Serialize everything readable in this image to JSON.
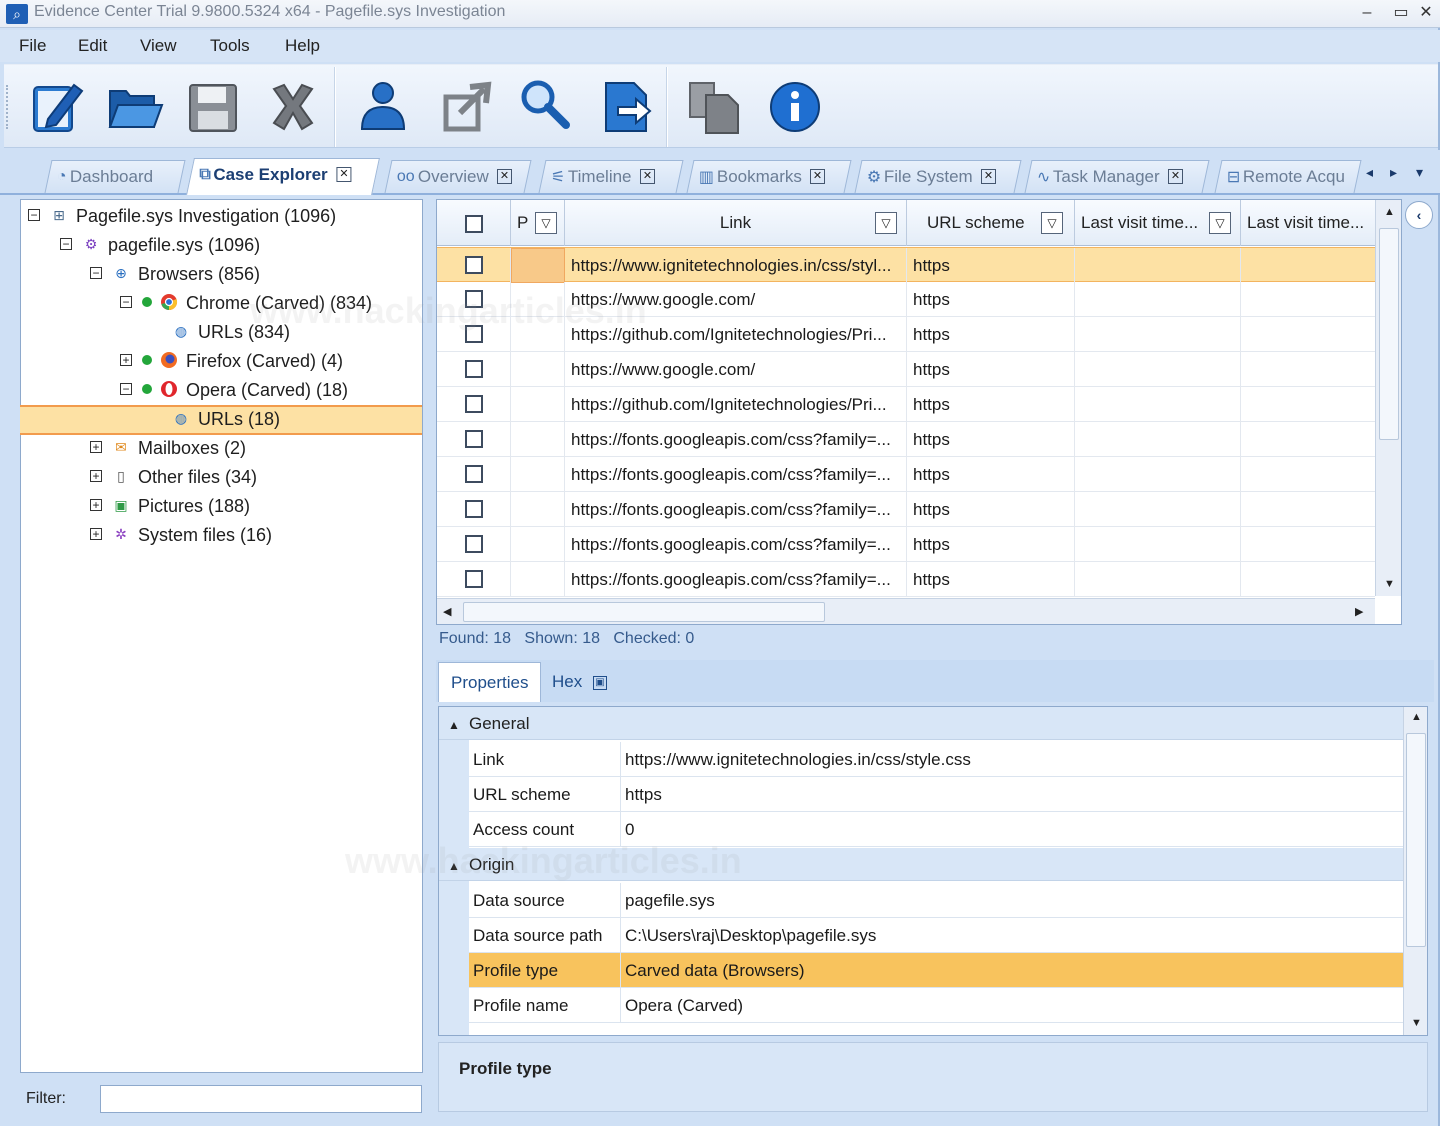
{
  "window": {
    "title": "Evidence Center Trial 9.9800.5324 x64 - Pagefile.sys Investigation"
  },
  "menu": [
    "File",
    "Edit",
    "View",
    "Tools",
    "Help"
  ],
  "toolbar": [
    "new-case",
    "open-case",
    "save-case",
    "close-case",
    "add-evidence",
    "export",
    "search",
    "report",
    "copy",
    "about"
  ],
  "tabs": [
    {
      "label": "Dashboard",
      "icon": "dashboard-icon",
      "closable": false,
      "active": false
    },
    {
      "label": "Case Explorer",
      "icon": "case-explorer-icon",
      "closable": true,
      "active": true
    },
    {
      "label": "Overview",
      "icon": "overview-icon",
      "closable": true,
      "active": false
    },
    {
      "label": "Timeline",
      "icon": "timeline-icon",
      "closable": true,
      "active": false
    },
    {
      "label": "Bookmarks",
      "icon": "bookmarks-icon",
      "closable": true,
      "active": false
    },
    {
      "label": "File System",
      "icon": "file-system-icon",
      "closable": true,
      "active": false
    },
    {
      "label": "Task Manager",
      "icon": "task-manager-icon",
      "closable": true,
      "active": false
    },
    {
      "label": "Remote Acqu",
      "icon": "remote-acquisition-icon",
      "closable": false,
      "active": false
    }
  ],
  "tree": [
    {
      "label": "Pagefile.sys Investigation (1096)",
      "level": 0,
      "expander": "⊟",
      "icon": "investigation-icon"
    },
    {
      "label": "pagefile.sys (1096)",
      "level": 1,
      "expander": "⊟",
      "icon": "gear-icon"
    },
    {
      "label": "Browsers (856)",
      "level": 2,
      "expander": "⊟",
      "icon": "globe-icon"
    },
    {
      "label": "Chrome (Carved) (834)",
      "level": 3,
      "expander": "⊟",
      "icon": "chrome-icon",
      "dot": true
    },
    {
      "label": "URLs (834)",
      "level": 4,
      "expander": "",
      "icon": "urls-icon"
    },
    {
      "label": "Firefox (Carved) (4)",
      "level": 3,
      "expander": "⊞",
      "icon": "firefox-icon",
      "dot": true
    },
    {
      "label": "Opera (Carved) (18)",
      "level": 3,
      "expander": "⊟",
      "icon": "opera-icon",
      "dot": true
    },
    {
      "label": "URLs (18)",
      "level": 4,
      "expander": "",
      "icon": "urls-icon",
      "selected": true
    },
    {
      "label": "Mailboxes (2)",
      "level": 2,
      "expander": "⊞",
      "icon": "mailbox-icon"
    },
    {
      "label": "Other files (34)",
      "level": 2,
      "expander": "⊞",
      "icon": "file-icon"
    },
    {
      "label": "Pictures (188)",
      "level": 2,
      "expander": "⊞",
      "icon": "picture-icon"
    },
    {
      "label": "System files (16)",
      "level": 2,
      "expander": "⊞",
      "icon": "system-files-icon"
    }
  ],
  "filter": {
    "label": "Filter:",
    "value": ""
  },
  "grid": {
    "columns": [
      "P",
      "Link",
      "URL scheme",
      "Last visit time...",
      "Last visit time..."
    ],
    "rows": [
      {
        "link": "https://www.ignitetechnologies.in/css/styl...",
        "scheme": "https",
        "selected": true
      },
      {
        "link": "https://www.google.com/",
        "scheme": "https"
      },
      {
        "link": "https://github.com/Ignitetechnologies/Pri...",
        "scheme": "https"
      },
      {
        "link": "https://www.google.com/",
        "scheme": "https"
      },
      {
        "link": "https://github.com/Ignitetechnologies/Pri...",
        "scheme": "https"
      },
      {
        "link": "https://fonts.googleapis.com/css?family=...",
        "scheme": "https"
      },
      {
        "link": "https://fonts.googleapis.com/css?family=...",
        "scheme": "https"
      },
      {
        "link": "https://fonts.googleapis.com/css?family=...",
        "scheme": "https"
      },
      {
        "link": "https://fonts.googleapis.com/css?family=...",
        "scheme": "https"
      },
      {
        "link": "https://fonts.googleapis.com/css?family=...",
        "scheme": "https"
      }
    ]
  },
  "status": {
    "found": "Found: 18",
    "shown": "Shown: 18",
    "checked": "Checked: 0"
  },
  "property_tabs": [
    "Properties",
    "Hex"
  ],
  "properties": {
    "general_label": "General",
    "general": [
      {
        "key": "Link",
        "value": "https://www.ignitetechnologies.in/css/style.css"
      },
      {
        "key": "URL scheme",
        "value": "https"
      },
      {
        "key": "Access count",
        "value": "0"
      }
    ],
    "origin_label": "Origin",
    "origin": [
      {
        "key": "Data source",
        "value": "pagefile.sys"
      },
      {
        "key": "Data source path",
        "value": "C:\\Users\\raj\\Desktop\\pagefile.sys"
      },
      {
        "key": "Profile type",
        "value": "Carved data (Browsers)",
        "highlight": true
      },
      {
        "key": "Profile name",
        "value": "Opera (Carved)"
      }
    ]
  },
  "description": {
    "title": "Profile type"
  },
  "watermark": "www.hackingarticles.in",
  "colors": {
    "selection": "#fde1a4",
    "selection_border": "#f29b4d",
    "accent": "#1f5fb5"
  }
}
